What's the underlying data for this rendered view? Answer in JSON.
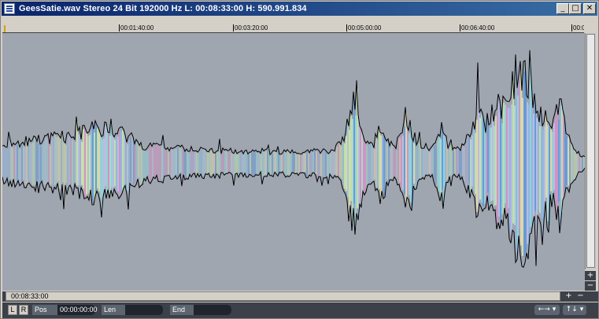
{
  "window": {
    "title": "GeesSatie.wav  Stereo 24 Bit 192000 Hz L: 00:08:33:00 H: 590.991.834",
    "minimize_glyph": "_",
    "maximize_glyph": "□",
    "close_glyph": "✕"
  },
  "ruler": {
    "ticks": [
      "00:01:40:00",
      "00:03:20:00",
      "00:05:00:00",
      "00:06:40:00",
      "00:0"
    ]
  },
  "waveform": {
    "background": "#a0a6b0",
    "outline_color": "#000000",
    "spectral_colors": [
      "#8fd8e0",
      "#c8e8a8",
      "#d890c8",
      "#90b8e8",
      "#e8e0a8",
      "#b0e0d0",
      "#5a9ae0",
      "#c0c0e8"
    ]
  },
  "scroll": {
    "time_readout": "00:08:33:00",
    "zoom_in": "+",
    "zoom_out": "−"
  },
  "status": {
    "left_channel": "L",
    "right_channel": "R",
    "pos_label": "Pos",
    "pos_value": "00:00:00:00",
    "len_label": "Len",
    "len_value": "",
    "end_label": "End",
    "end_value": "",
    "nav_horizontal": "←→ ▾",
    "nav_vertical": "↑↓ ▾"
  }
}
